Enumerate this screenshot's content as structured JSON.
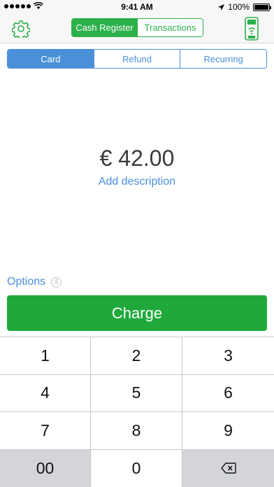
{
  "status_bar": {
    "time": "9:41 AM",
    "battery": "100%",
    "battery_level": 1.0
  },
  "nav": {
    "tabs": [
      {
        "label": "Cash Register",
        "active": true
      },
      {
        "label": "Transactions",
        "active": false
      }
    ],
    "left_icon": "gear-icon",
    "right_icon": "card-terminal-icon"
  },
  "payment_types": [
    {
      "label": "Card",
      "active": true
    },
    {
      "label": "Refund",
      "active": false
    },
    {
      "label": "Recurring",
      "active": false
    }
  ],
  "amount": "€ 42.00",
  "add_description": "Add description",
  "options": {
    "label": "Options",
    "icon": "dollar-circle-icon",
    "icon_glyph": "$"
  },
  "charge_label": "Charge",
  "keypad": {
    "keys": [
      "1",
      "2",
      "3",
      "4",
      "5",
      "6",
      "7",
      "8",
      "9",
      "00",
      "0"
    ],
    "backspace_icon": "backspace-icon"
  },
  "colors": {
    "green": "#2bb04a",
    "charge_green": "#1fa93a",
    "blue": "#4a90d9"
  }
}
